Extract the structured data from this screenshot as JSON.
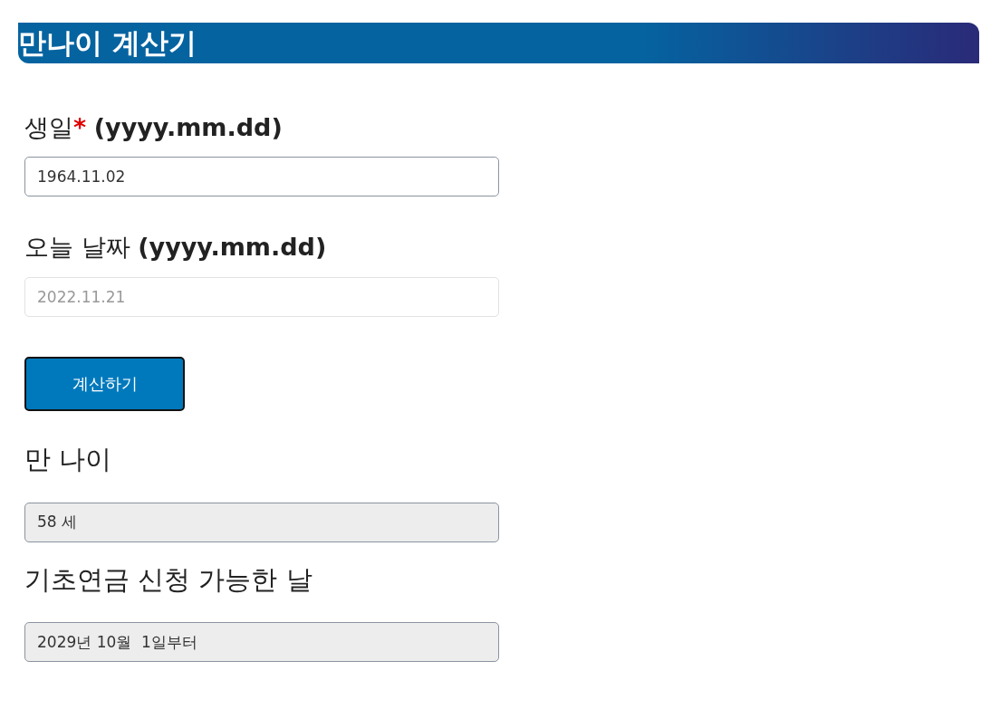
{
  "header": {
    "title": "만나이 계산기"
  },
  "fields": [
    {
      "kind": "input",
      "label": "생일",
      "required_mark": "*",
      "format": "(yyyy.mm.dd)",
      "value": "1964.11.02"
    },
    {
      "kind": "input",
      "label": "오늘 날짜",
      "format": "(yyyy.mm.dd)",
      "placeholder": "2022.11.21"
    },
    {
      "kind": "button",
      "label": "계산하기"
    },
    {
      "kind": "result",
      "label": "만 나이",
      "value": "58 세"
    },
    {
      "kind": "result",
      "label": "기초연금 신청 가능한 날",
      "value": "2029년 10월  1일부터"
    }
  ]
}
